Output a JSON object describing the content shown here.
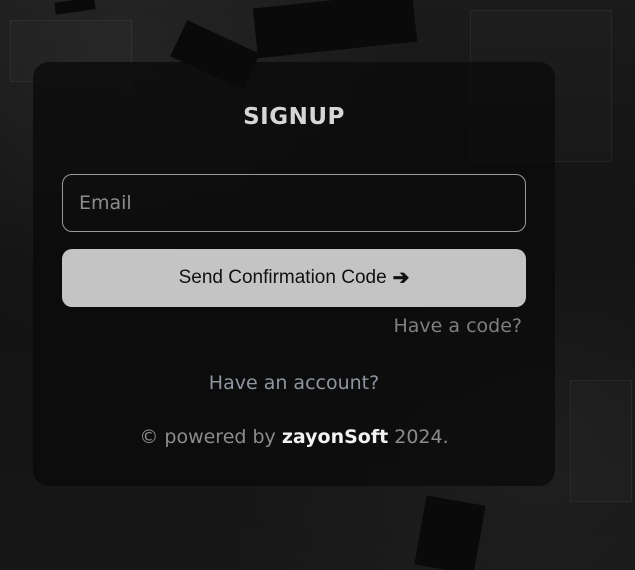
{
  "form": {
    "title": "SIGNUP",
    "email_placeholder": "Email",
    "email_value": "",
    "send_button_label": "Send Confirmation Code",
    "send_button_icon": "arrow-right-icon",
    "have_code_link": "Have a code?",
    "have_account_link": "Have an account?"
  },
  "footer": {
    "prefix": "© powered by",
    "brand": "zayonSoft",
    "year": "2024."
  },
  "colors": {
    "background": "#141414",
    "card": "#0a0a0a",
    "button": "#c3c4c3",
    "title": "#d6d6d6",
    "link": "#8f96a0"
  }
}
